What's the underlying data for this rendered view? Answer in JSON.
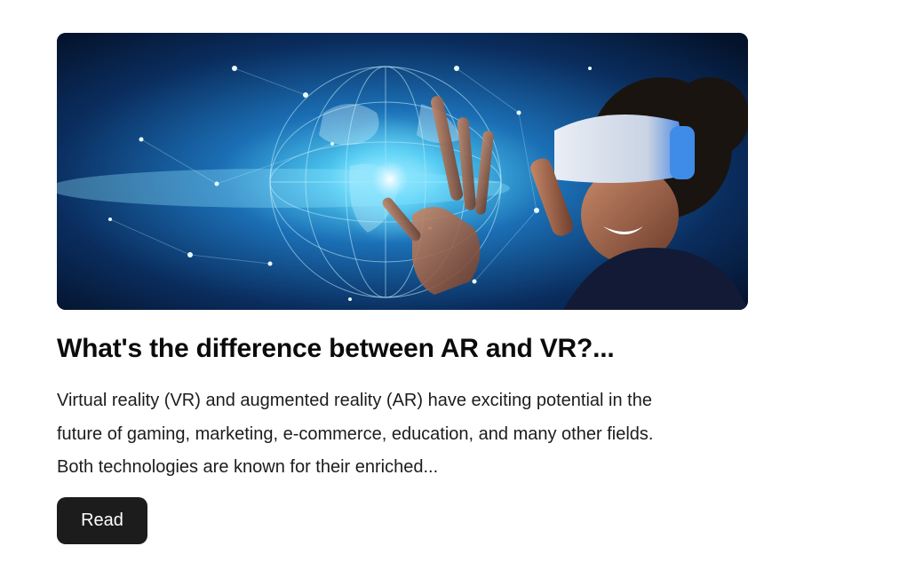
{
  "article": {
    "image": {
      "icon": "vr-globe-photo",
      "colors": {
        "deep": "#061a3a",
        "glow": "#7fe3ff",
        "mid": "#1b6fb5"
      }
    },
    "title": "What's the difference between AR and VR?...",
    "excerpt_lines": [
      "Virtual reality (VR) and augmented reality (AR) have exciting potential in the",
      "future of gaming, marketing, e-commerce, education, and many other fields.",
      "Both technologies are known for their enriched..."
    ],
    "read_label": "Read"
  }
}
